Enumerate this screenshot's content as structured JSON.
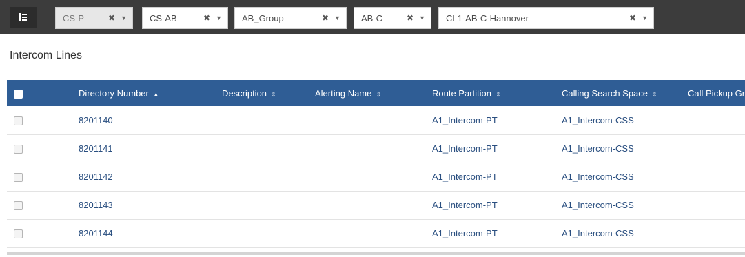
{
  "filters": [
    {
      "label": "CS-P",
      "disabled": true
    },
    {
      "label": "CS-AB",
      "disabled": false
    },
    {
      "label": "AB_Group",
      "disabled": false
    },
    {
      "label": "AB-C",
      "disabled": false
    },
    {
      "label": "CL1-AB-C-Hannover",
      "disabled": false
    }
  ],
  "section_title": "Intercom Lines",
  "columns": [
    "Directory Number",
    "Description",
    "Alerting Name",
    "Route Partition",
    "Calling Search Space",
    "Call Pickup Group"
  ],
  "rows": [
    {
      "directory_number": "8201140",
      "description": "",
      "alerting_name": "",
      "route_partition": "A1_Intercom-PT",
      "calling_search_space": "A1_Intercom-CSS"
    },
    {
      "directory_number": "8201141",
      "description": "",
      "alerting_name": "",
      "route_partition": "A1_Intercom-PT",
      "calling_search_space": "A1_Intercom-CSS"
    },
    {
      "directory_number": "8201142",
      "description": "",
      "alerting_name": "",
      "route_partition": "A1_Intercom-PT",
      "calling_search_space": "A1_Intercom-CSS"
    },
    {
      "directory_number": "8201143",
      "description": "",
      "alerting_name": "",
      "route_partition": "A1_Intercom-PT",
      "calling_search_space": "A1_Intercom-CSS"
    },
    {
      "directory_number": "8201144",
      "description": "",
      "alerting_name": "",
      "route_partition": "A1_Intercom-PT",
      "calling_search_space": "A1_Intercom-CSS"
    }
  ],
  "colors": {
    "topbar": "#3c3c3c",
    "header": "#2f5d95",
    "link_text": "#2a4f80"
  },
  "icons": {
    "menu": "list-toggle-icon",
    "clear": "clear-icon",
    "dropdown": "caret-down-icon",
    "sort_asc": "sort-ascending-icon",
    "sortable": "sortable-icon"
  }
}
